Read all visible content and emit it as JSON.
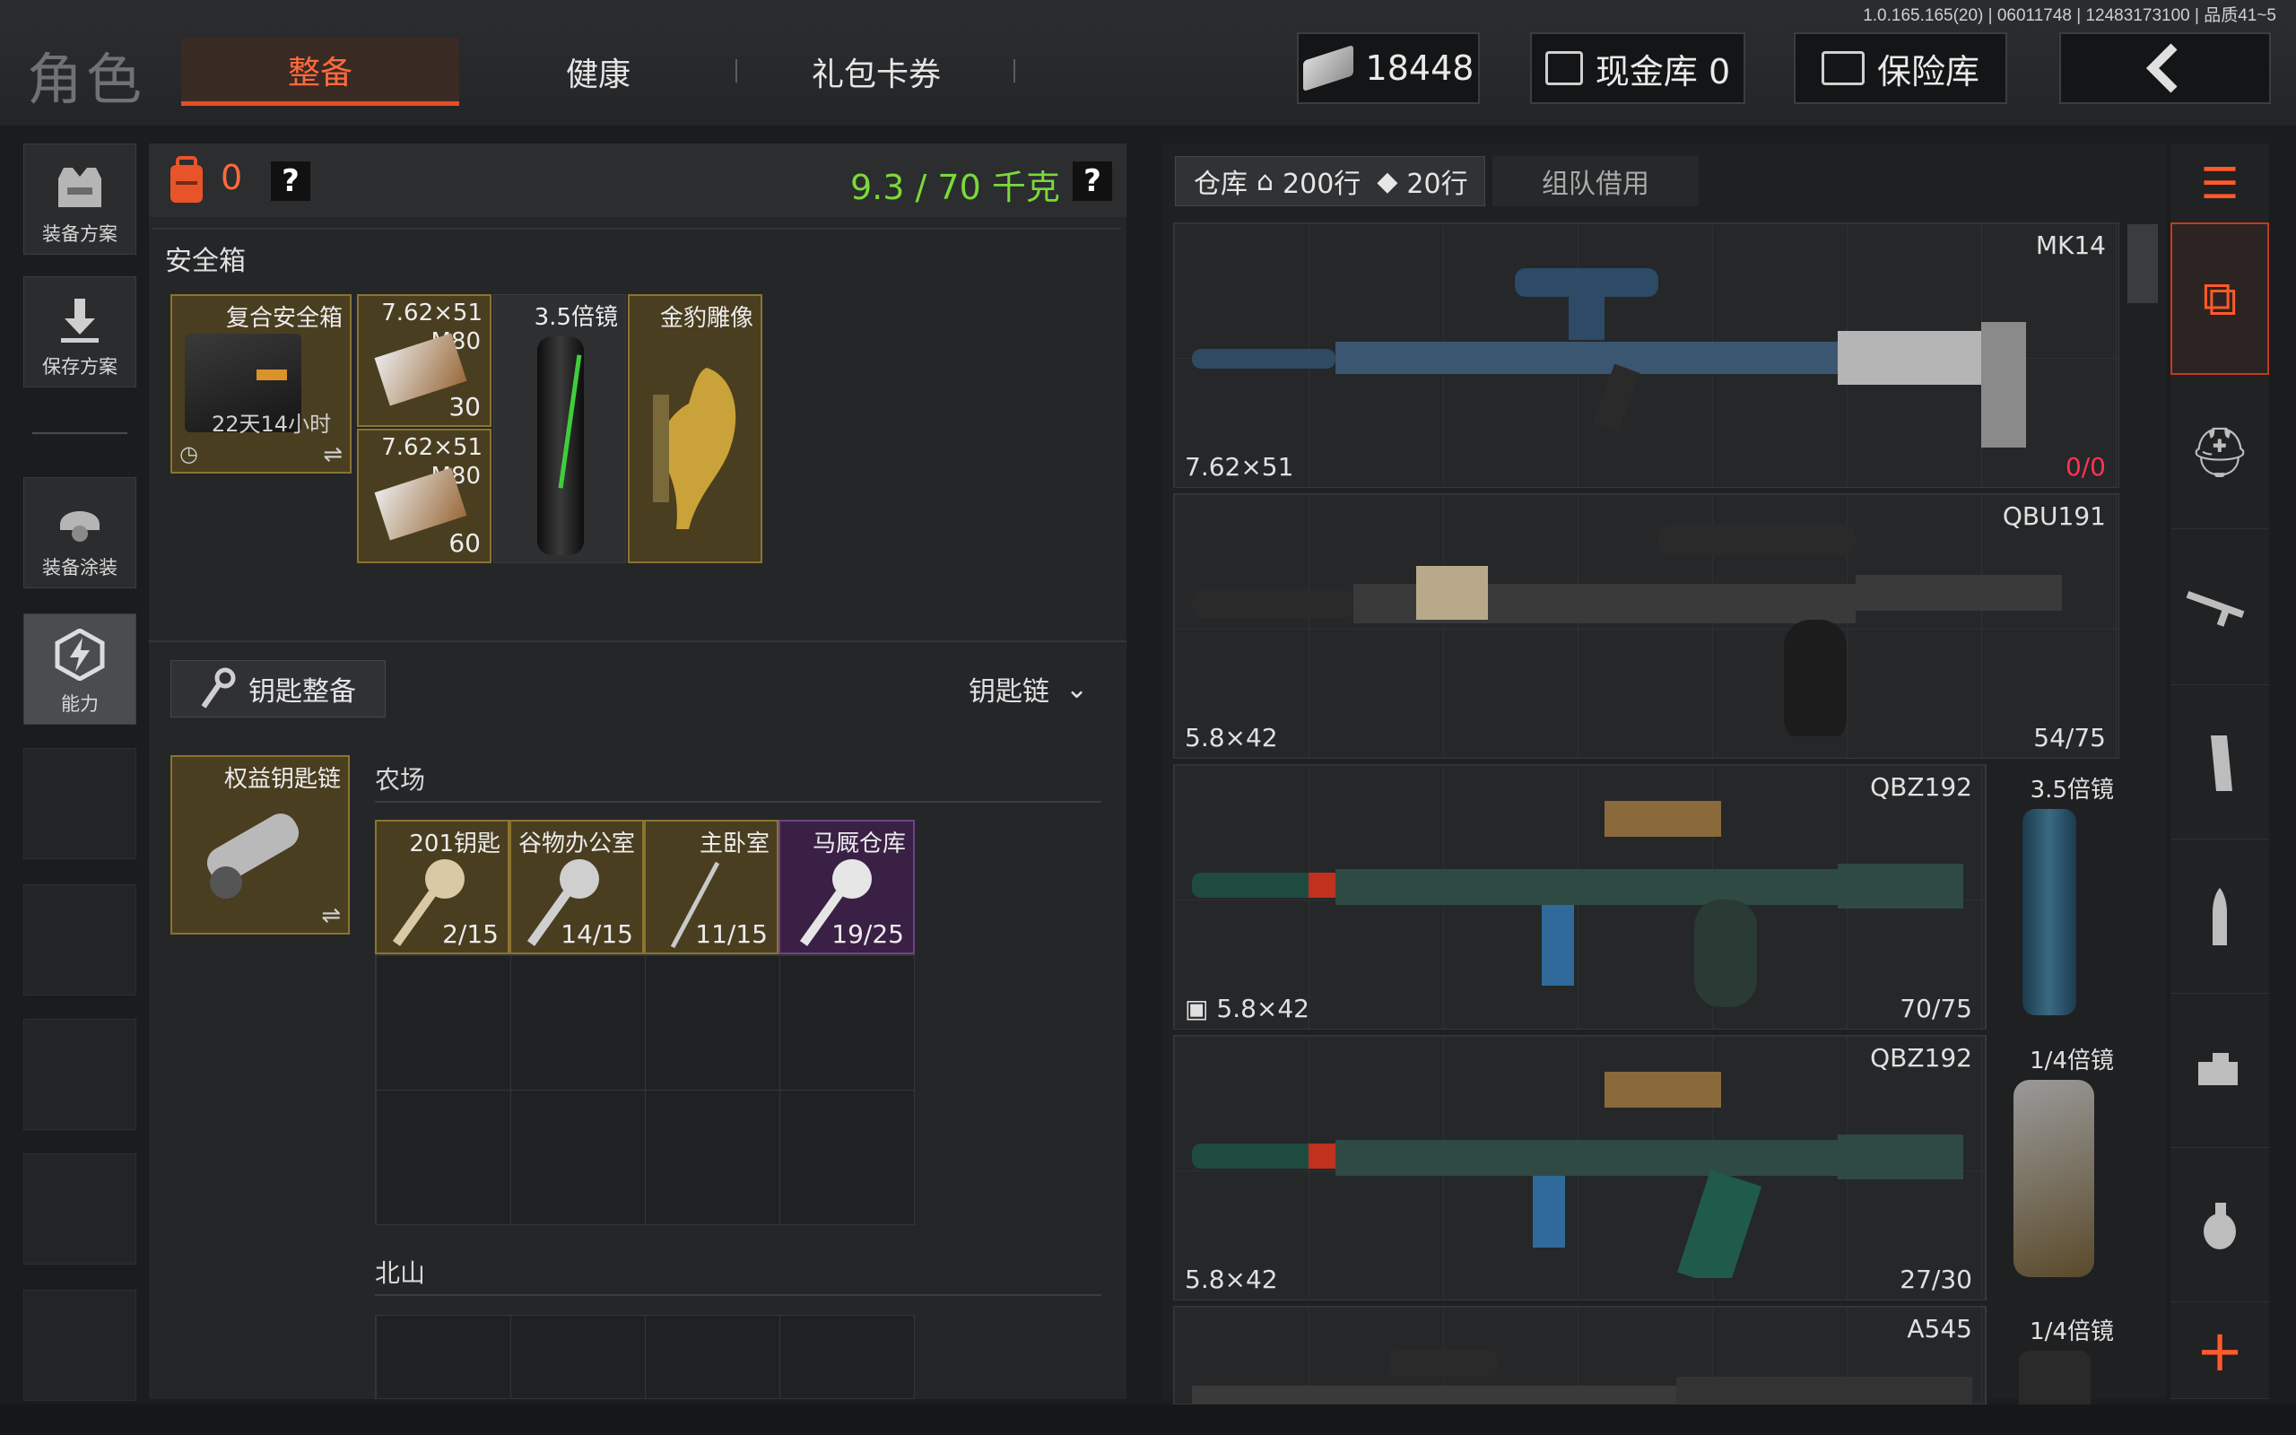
{
  "version": "1.0.165.165(20) | 06011748 | 12483173100 | 品质41~5",
  "header": {
    "title": "角色",
    "tabs": [
      {
        "label": "整备",
        "active": true
      },
      {
        "label": "健康",
        "active": false
      },
      {
        "label": "礼包卡券",
        "active": false
      }
    ],
    "money": "18448",
    "cash_vault": "现金库 0",
    "safe_vault": "保险库",
    "back_icon": "chevron-left-icon"
  },
  "left_rail": [
    {
      "label": "装备方案",
      "icon": "vest-icon"
    },
    {
      "label": "保存方案",
      "icon": "download-icon"
    },
    {
      "label": "装备涂装",
      "icon": "helmet-icon"
    },
    {
      "label": "能力",
      "icon": "lightning-icon",
      "active": true
    }
  ],
  "loadout": {
    "count": "0",
    "weight": "9.3 / 70 千克",
    "help": "?",
    "safebox_title": "安全箱",
    "safebox": {
      "label": "复合安全箱",
      "timer": "22天14小时"
    },
    "safebox_items": [
      {
        "label": "7.62×51",
        "sub": "M80",
        "count": "30"
      },
      {
        "label": "7.62×51",
        "sub": "M80",
        "count": "60"
      },
      {
        "label": "3.5倍镜"
      },
      {
        "label": "金豹雕像"
      }
    ]
  },
  "keys": {
    "button": "钥匙整备",
    "dropdown": "钥匙链",
    "keychain": "权益钥匙链",
    "section1": "农场",
    "section2": "北山",
    "items": [
      {
        "label": "201钥匙",
        "count": "2/15"
      },
      {
        "label": "谷物办公室",
        "count": "14/15"
      },
      {
        "label": "主卧室",
        "count": "11/15"
      },
      {
        "label": "马厩仓库",
        "count": "19/25"
      }
    ]
  },
  "warehouse": {
    "tab": "仓库",
    "rows1": "200行",
    "rows2": "20行",
    "team_tab": "组队借用",
    "weapons": [
      {
        "name": "MK14",
        "caliber": "7.62×51",
        "ammo": "0/0",
        "scope": ""
      },
      {
        "name": "QBU191",
        "caliber": "5.8×42",
        "ammo": "54/75",
        "scope": ""
      },
      {
        "name": "QBZ192",
        "caliber": "5.8×42",
        "ammo": "70/75",
        "scope": "3.5倍镜"
      },
      {
        "name": "QBZ192",
        "caliber": "5.8×42",
        "ammo": "27/30",
        "scope": "1/4倍镜"
      },
      {
        "name": "A545",
        "caliber": "",
        "ammo": "",
        "scope": "1/4倍镜"
      }
    ]
  },
  "colors": {
    "accent": "#e84d25",
    "weight_green": "#7bd93a",
    "ammo_red": "#ff3355"
  }
}
